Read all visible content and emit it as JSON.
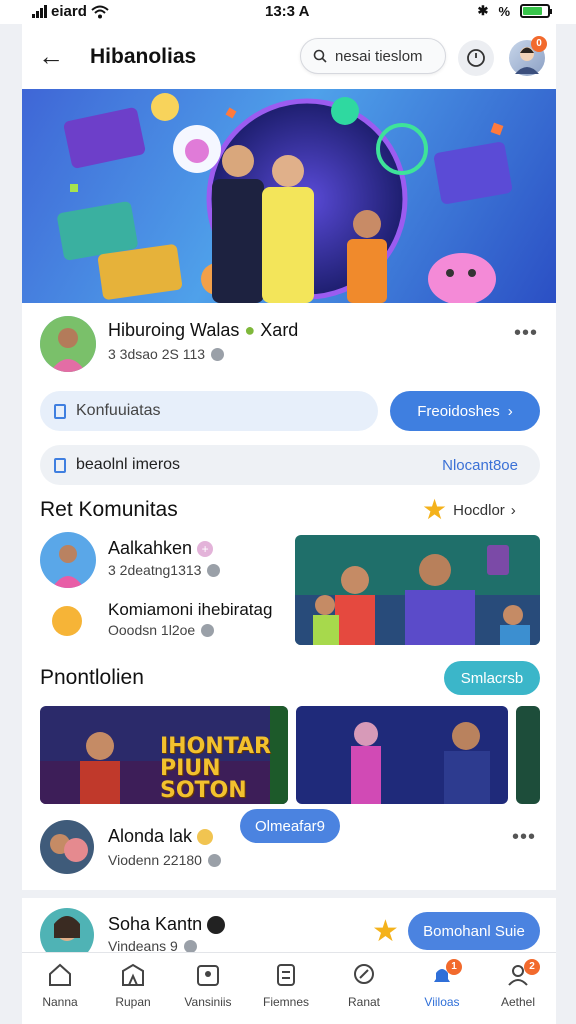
{
  "status_bar": {
    "carrier": "eiard",
    "time": "13:3 A",
    "battery_icon": "battery-icon",
    "wifi_icon": "wifi-icon"
  },
  "header": {
    "title": "Hibanolias",
    "search_text": "nesai tieslom",
    "back_icon": "arrow-left-icon",
    "search_icon": "search-icon",
    "clock_icon": "clock-icon",
    "notification_count": "0"
  },
  "featured": {
    "name": "Hiburoing Walas",
    "name_suffix": "Xard",
    "meta": "3 3dsao 2S 113"
  },
  "actions": {
    "input_label": "Konfuuiatas",
    "primary_button": "Freoidoshes",
    "secondary_label": "beaolnl imeros",
    "secondary_link": "Nlocant8oe"
  },
  "komunitas": {
    "title": "Ret Komunitas",
    "link": "Hocdlor",
    "items": [
      {
        "name": "Aalkahken",
        "meta": "3 2deatng1313"
      },
      {
        "name": "Komiamoni ihebiratag",
        "meta": "Ooodsn 1l2oe"
      }
    ]
  },
  "promosi": {
    "title": "Pnontlolien",
    "button": "Smlacrsb",
    "banner_text_line1": "IHONTAR",
    "banner_text_line2": "PIUN SOTON"
  },
  "posts": [
    {
      "name": "Alonda lak",
      "meta": "Viodenn 22180",
      "chip": "Olmeafar9"
    },
    {
      "name": "Soha Kantn",
      "meta": "Vindeans 9",
      "chip": "Bomohanl Suie"
    }
  ],
  "tabbar": {
    "items": [
      {
        "label": "Nanna",
        "icon": "home-icon"
      },
      {
        "label": "Rupan",
        "icon": "store-icon"
      },
      {
        "label": "Vansiniis",
        "icon": "album-icon"
      },
      {
        "label": "Fiemnes",
        "icon": "grid-icon"
      },
      {
        "label": "Ranat",
        "icon": "pin-icon"
      },
      {
        "label": "Viiloas",
        "icon": "bell-icon",
        "badge": "1"
      },
      {
        "label": "Aethel",
        "icon": "user-icon",
        "badge": "2"
      }
    ],
    "active_index": 5
  },
  "colors": {
    "accent": "#3f7fe0",
    "teal": "#3bb6c9",
    "badge": "#f26a2d"
  }
}
